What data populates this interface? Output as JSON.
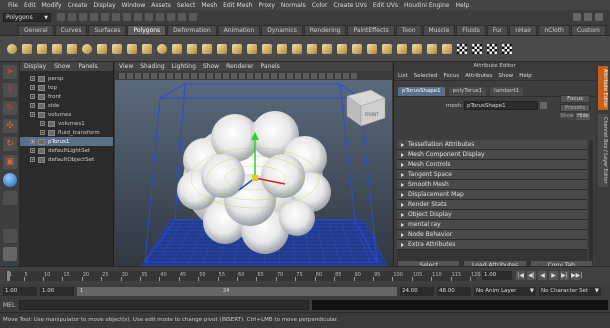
{
  "menubar": {
    "items": [
      "File",
      "Edit",
      "Modify",
      "Create",
      "Display",
      "Window",
      "Assets",
      "Select",
      "Mesh",
      "Edit Mesh",
      "Proxy",
      "Normals",
      "Color",
      "Create UVs",
      "Edit UVs",
      "Houdini Engine",
      "Help"
    ]
  },
  "statusline": {
    "mode": "Polygons"
  },
  "shelf": {
    "tabs": [
      "General",
      "Curves",
      "Surfaces",
      "Polygons",
      "Deformation",
      "Animation",
      "Dynamics",
      "Rendering",
      "PaintEffects",
      "Toon",
      "Muscle",
      "Fluids",
      "Fur",
      "nHair",
      "nCloth",
      "Custom"
    ],
    "active_tab": "Polygons"
  },
  "outliner": {
    "menu": [
      "Display",
      "Show",
      "Panels"
    ],
    "items": [
      {
        "label": "persp",
        "indent": false,
        "selected": false
      },
      {
        "label": "top",
        "indent": false,
        "selected": false
      },
      {
        "label": "front",
        "indent": false,
        "selected": false
      },
      {
        "label": "side",
        "indent": false,
        "selected": false
      },
      {
        "label": "volumes",
        "indent": false,
        "selected": false
      },
      {
        "label": "volumes1",
        "indent": true,
        "selected": false
      },
      {
        "label": "fluid_transform",
        "indent": true,
        "selected": false
      },
      {
        "label": "pTorus1",
        "indent": false,
        "selected": true
      },
      {
        "label": "defaultLightSet",
        "indent": false,
        "selected": false
      },
      {
        "label": "defaultObjectSet",
        "indent": false,
        "selected": false
      }
    ]
  },
  "viewport": {
    "menu": [
      "View",
      "Shading",
      "Lighting",
      "Show",
      "Renderer",
      "Panels"
    ],
    "viewcube_label": "FRONT",
    "colors": {
      "background_top": "#5a6a7c",
      "background_bottom": "#2a3038",
      "grid": "#1d3a9a",
      "bbox": "#2b4bd8",
      "cloud": "#f4f4f4"
    }
  },
  "attribute_editor": {
    "title": "Attribute Editor",
    "menu": [
      "List",
      "Selected",
      "Focus",
      "Attributes",
      "Show",
      "Help"
    ],
    "tabs": [
      "pTorusShape1",
      "polyTorus1",
      "lambert1"
    ],
    "active_tab": "pTorusShape1",
    "mesh_label": "mesh:",
    "mesh_value": "pTorusShape1",
    "focus_label": "Focus",
    "presets_label": "Presets",
    "show_label": "Show",
    "hide_label": "Hide",
    "sections": [
      "Tessellation Attributes",
      "Mesh Component Display",
      "Mesh Controls",
      "Tangent Space",
      "Smooth Mesh",
      "Displacement Map",
      "Render Stats",
      "Object Display",
      "mental ray",
      "Node Behavior",
      "Extra Attributes"
    ],
    "buttons": {
      "select": "Select",
      "load": "Load Attributes",
      "copy": "Copy Tab"
    }
  },
  "side_tabs": [
    "Attribute Editor",
    "Channel Box / Layer Editor"
  ],
  "timeslider": {
    "ticks": [
      1,
      5,
      10,
      15,
      20,
      25,
      30,
      35,
      40,
      45,
      50,
      55,
      60,
      65,
      70,
      75,
      80,
      85,
      90,
      95,
      100,
      105,
      110,
      115,
      120
    ],
    "current_frame": "1.00",
    "playback": [
      "|◀",
      "◀|",
      "◀",
      "▶",
      "▶|",
      "▶▶|"
    ]
  },
  "rangeslider": {
    "start": "1.00",
    "inner_start": "1.00",
    "bar_start": "1",
    "bar_end": "24",
    "end_inner": "24.00",
    "end": "48.00",
    "anim_layer": "No Anim Layer",
    "char_set": "No Character Set"
  },
  "mel": {
    "label": "MEL"
  },
  "help": {
    "text": "Move Tool: Use manipulator to move object(s). Use edit mode to change pivot (INSERT). Ctrl+LMB to move perpendicular."
  }
}
